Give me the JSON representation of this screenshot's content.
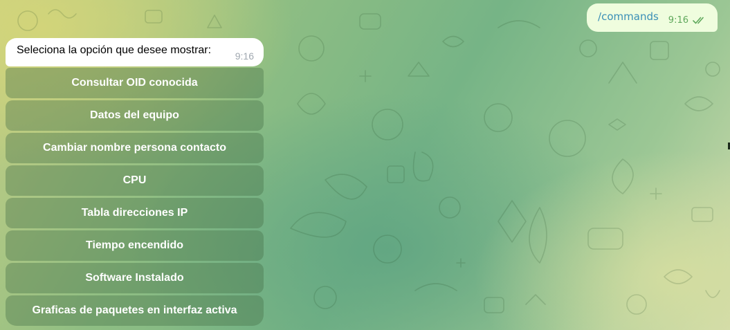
{
  "chat": {
    "outgoing": {
      "text": "/commands",
      "time": "9:16",
      "status_icon": "double-check-icon",
      "color_text": "#3a8fb7",
      "color_time": "#5fa85c"
    },
    "incoming": {
      "text": "Seleciona la opción que desee mostrar:",
      "time": "9:16"
    },
    "keyboard": {
      "buttons": [
        {
          "label": "Consultar OID conocida"
        },
        {
          "label": "Datos del equipo"
        },
        {
          "label": "Cambiar nombre persona contacto"
        },
        {
          "label": "CPU"
        },
        {
          "label": "Tabla direcciones IP"
        },
        {
          "label": "Tiempo encendido"
        },
        {
          "label": "Software Instalado"
        },
        {
          "label": "Graficas de paquetes en interfaz activa"
        }
      ]
    }
  }
}
